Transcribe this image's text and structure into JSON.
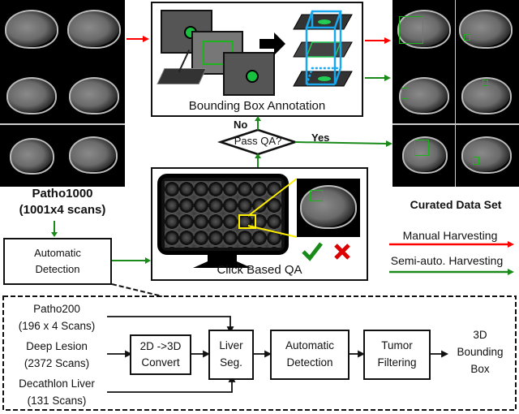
{
  "source": {
    "title": "Patho1000",
    "subtitle": "(1001x4 scans)"
  },
  "annotation_panel": {
    "label": "Bounding Box Annotation"
  },
  "decision": {
    "label": "Pass QA?",
    "no_label": "No",
    "yes_label": "Yes"
  },
  "qa_panel": {
    "label": "Click Based QA",
    "accept_icon": "check-icon",
    "reject_icon": "cross-icon"
  },
  "curated": {
    "title": "Curated Data Set"
  },
  "auto_detection": {
    "line1": "Automatic",
    "line2": "Detection"
  },
  "legend": {
    "manual": "Manual Harvesting",
    "semi": "Semi-auto. Harvesting",
    "manual_color": "#ff0000",
    "semi_color": "#1a8a1a"
  },
  "pipeline": {
    "inputs": [
      {
        "name": "Patho200",
        "detail": "(196 x 4 Scans)"
      },
      {
        "name": "Deep Lesion",
        "detail": "(2372 Scans)"
      },
      {
        "name": "Decathlon Liver",
        "detail": "(131 Scans)"
      }
    ],
    "convert": {
      "line1": "2D ->3D",
      "line2": "Convert"
    },
    "liver_seg": {
      "line1": "Liver",
      "line2": "Seg."
    },
    "detection": {
      "line1": "Automatic",
      "line2": "Detection"
    },
    "filtering": {
      "line1": "Tumor",
      "line2": "Filtering"
    },
    "output": {
      "line1": "3D",
      "line2": "Bounding",
      "line3": "Box"
    }
  }
}
